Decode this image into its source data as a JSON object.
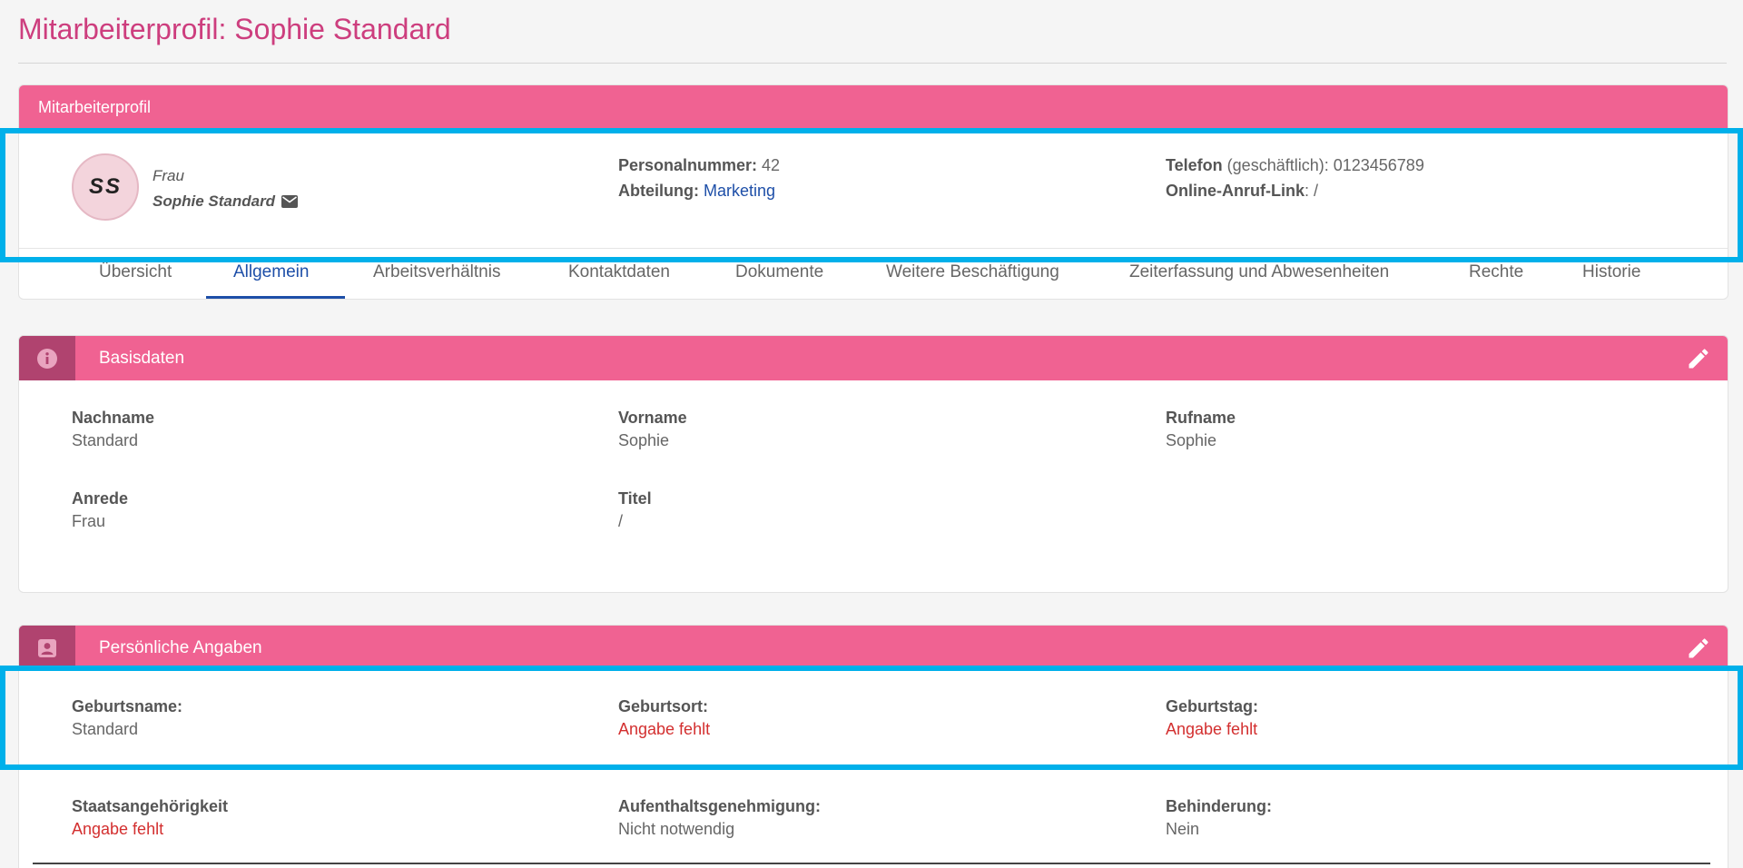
{
  "page_title": "Mitarbeiterprofil: Sophie Standard",
  "profile": {
    "header": "Mitarbeiterprofil",
    "initials": "SS",
    "salutation": "Frau",
    "name": "Sophie Standard",
    "personalnummer_label": "Personalnummer:",
    "personalnummer": " 42",
    "abteilung_label": "Abteilung:",
    "abteilung": "Marketing",
    "telefon_label": "Telefon",
    "telefon_suffix": " (geschäftlich): 0123456789",
    "online_label": "Online-Anruf-Link",
    "online_value": ": /"
  },
  "tabs": [
    "Übersicht",
    "Allgemein",
    "Arbeitsverhältnis",
    "Kontaktdaten",
    "Dokumente",
    "Weitere Beschäftigung",
    "Zeiterfassung und Abwesenheiten",
    "Rechte",
    "Historie"
  ],
  "active_tab": "Allgemein",
  "basisdaten": {
    "title": "Basisdaten",
    "fields": [
      {
        "label": "Nachname",
        "value": "Standard"
      },
      {
        "label": "Vorname",
        "value": "Sophie"
      },
      {
        "label": "Rufname",
        "value": "Sophie"
      },
      {
        "label": "Anrede",
        "value": "Frau"
      },
      {
        "label": "Titel",
        "value": "/"
      }
    ]
  },
  "persoenlich": {
    "title": "Persönliche Angaben",
    "fields": [
      {
        "label": "Geburtsname:",
        "value": "Standard"
      },
      {
        "label": "Geburtsort:",
        "value": "Angabe fehlt"
      },
      {
        "label": "Geburtstag:",
        "value": "Angabe fehlt"
      },
      {
        "label": "Staatsangehörigkeit",
        "value": "Angabe fehlt"
      },
      {
        "label": "Aufenthaltsgenehmigung:",
        "value": "Nicht notwendig"
      },
      {
        "label": "Behinderung:",
        "value": "Nein"
      }
    ]
  },
  "colors": {
    "header_pink": "#f06292",
    "title_pink": "#cd3e7e",
    "icon_box": "#b0436f",
    "link_blue": "#1e4fa8",
    "missing_red": "#d32f2f",
    "highlight_blue": "#00b0ea"
  },
  "icons": {
    "mail": "mail-icon",
    "info": "info-icon",
    "contact": "contact-card-icon",
    "edit": "pencil-icon"
  }
}
